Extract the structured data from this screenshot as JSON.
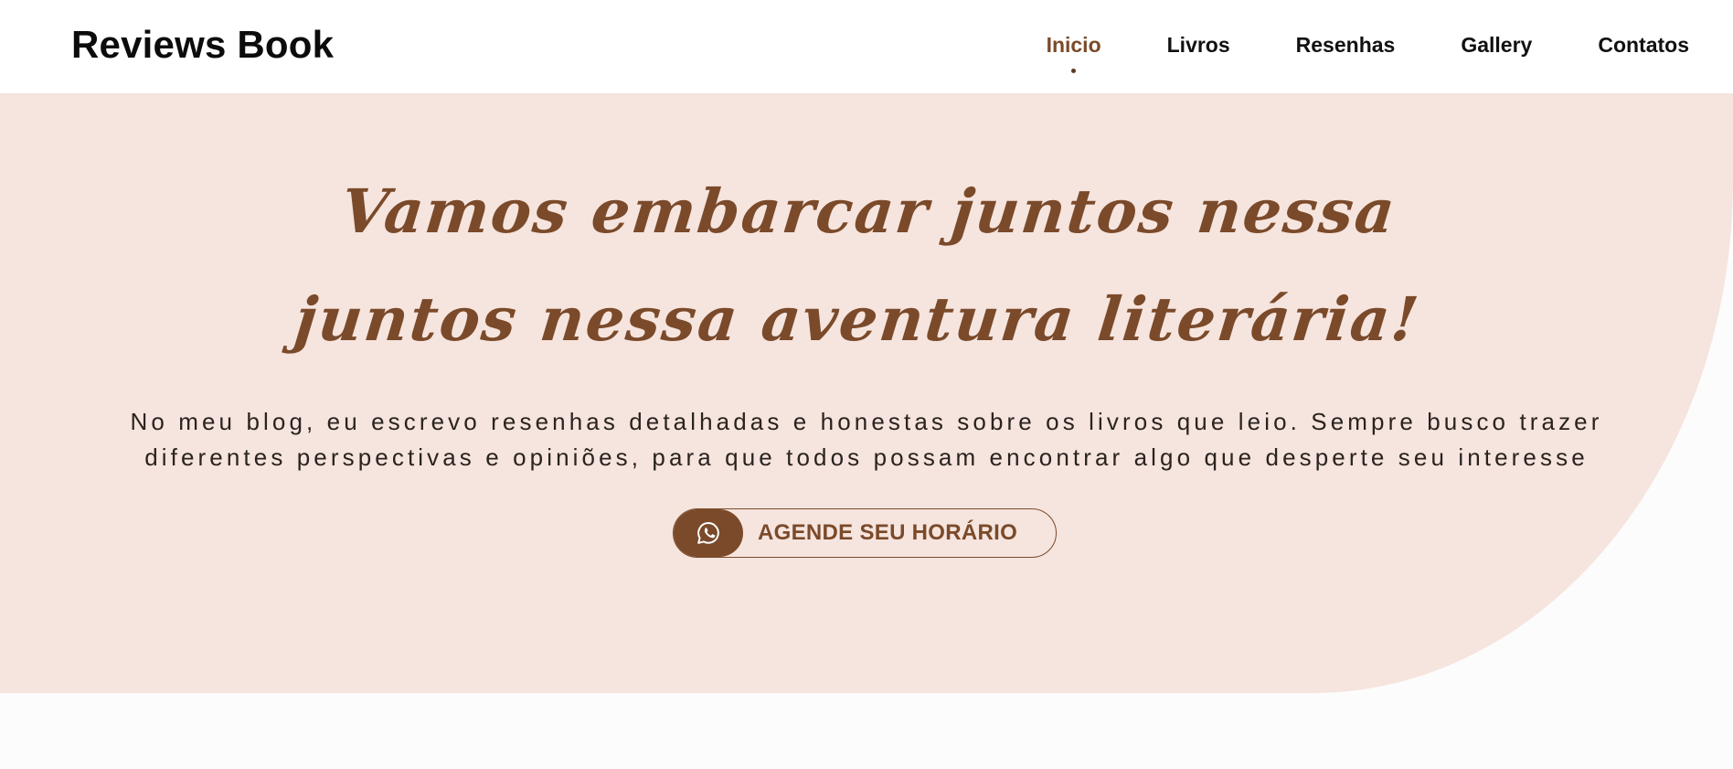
{
  "header": {
    "brand": "Reviews Book",
    "nav": [
      {
        "label": "Inicio",
        "active": true
      },
      {
        "label": "Livros",
        "active": false
      },
      {
        "label": "Resenhas",
        "active": false
      },
      {
        "label": "Gallery",
        "active": false
      },
      {
        "label": "Contatos",
        "active": false
      }
    ]
  },
  "hero": {
    "title_line1": "Vamos embarcar juntos nessa",
    "title_line2": "juntos nessa aventura literária!",
    "description": "No meu blog, eu escrevo resenhas detalhadas e honestas sobre os livros que leio. Sempre busco trazer diferentes perspectivas e opiniões, para que todos possam encontrar algo que desperte seu interesse",
    "cta": {
      "icon": "whatsapp-icon",
      "label": "AGENDE SEU HORÁRIO"
    }
  },
  "colors": {
    "accent": "#7a4a2a",
    "hero_background": "#f6e4de",
    "header_background": "#ffffff",
    "text_dark": "#111111"
  }
}
